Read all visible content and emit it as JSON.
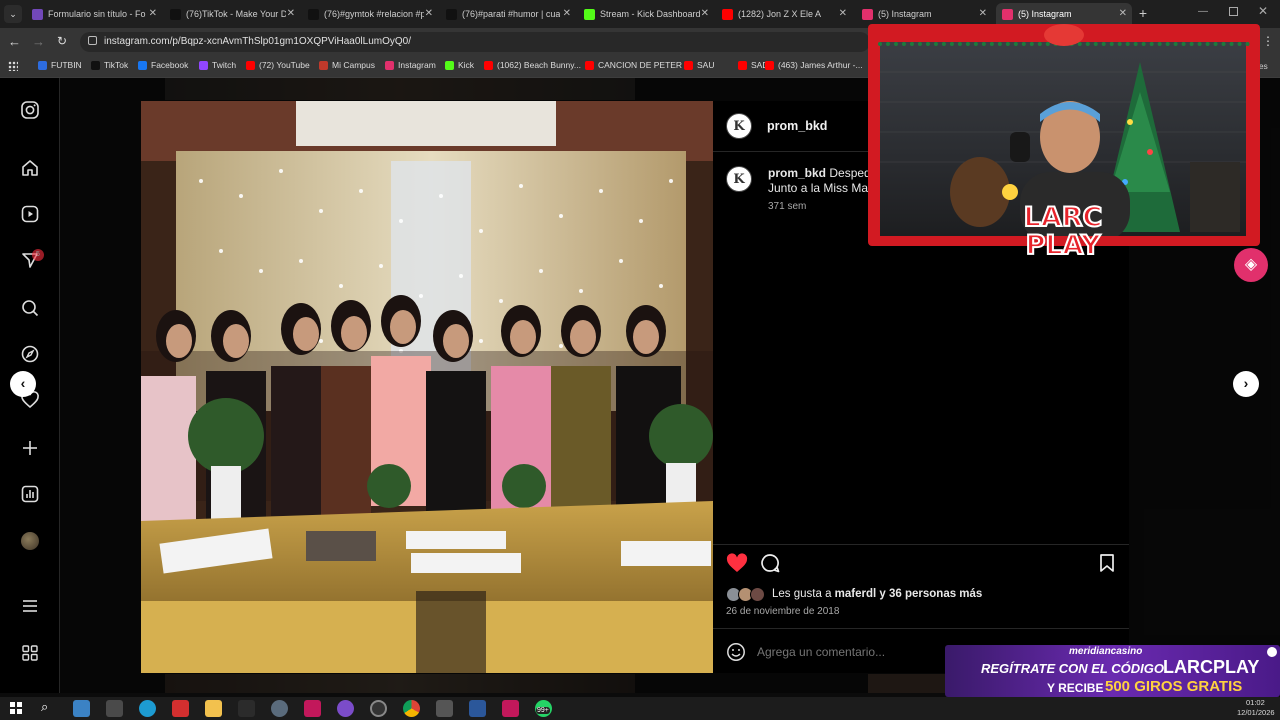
{
  "browser": {
    "tabs": [
      {
        "title": "Formulario sin título - Fo",
        "color": "#7248b9"
      },
      {
        "title": "(76)TikTok - Make Your D",
        "color": "#111111"
      },
      {
        "title": "(76)#gymtok #relacion #p",
        "color": "#111111"
      },
      {
        "title": "(76)#parati #humor | cua",
        "color": "#111111"
      },
      {
        "title": "Stream - Kick Dashboard",
        "color": "#53fc18"
      },
      {
        "title": "(1282) Jon Z X Ele A",
        "color": "#ff0000"
      },
      {
        "title": "(5) Instagram",
        "color": "#e1306c"
      },
      {
        "title": "(5) Instagram",
        "color": "#e1306c"
      }
    ],
    "url": "instagram.com/p/Bqpz-xcnAvmThSlp01gm1OXQPViHaa0lLumOyQ0/",
    "bookmarks": [
      {
        "label": "FUTBIN",
        "color": "#2d6cdf"
      },
      {
        "label": "TikTok",
        "color": "#111111"
      },
      {
        "label": "Facebook",
        "color": "#1877f2"
      },
      {
        "label": "Twitch",
        "color": "#9146ff"
      },
      {
        "label": "(72) YouTube",
        "color": "#ff0000"
      },
      {
        "label": "Mi Campus",
        "color": "#c0392b"
      },
      {
        "label": "Instagram",
        "color": "#e1306c"
      },
      {
        "label": "Kick",
        "color": "#53fc18"
      },
      {
        "label": "(1062) Beach Bunny...",
        "color": "#ff0000"
      },
      {
        "label": "CANCION DE PETER",
        "color": "#ff0000"
      },
      {
        "label": "SAU",
        "color": "#ff0000"
      },
      {
        "label": "SAD",
        "color": "#ff0000"
      },
      {
        "label": "(463) James Arthur -...",
        "color": "#ff0000"
      }
    ],
    "bookmarks_overflow": "res"
  },
  "sidebar": {
    "notification_badge": "5"
  },
  "post": {
    "username": "prom_bkd",
    "caption_user": "prom_bkd",
    "caption_line1": "Despedid",
    "caption_line2": "Junto a la Miss Marth",
    "caption_time": "371 sem",
    "likes_prefix": "Les gusta a ",
    "likes_user": "maferdl",
    "likes_suffix": " y 36 personas más",
    "date": "26 de noviembre de 2018",
    "comment_placeholder": "Agrega un comentario..."
  },
  "overlay": {
    "brand_line1": "LARC",
    "brand_line2": "PLAY",
    "ad_brand": "meridiancasino",
    "ad_line1": "REGÍTRATE CON EL CÓDIGO",
    "ad_code": "LARCPLAY",
    "ad_line2_prefix": "Y RECIBE",
    "ad_line2_highlight": "500 GIROS GRATIS"
  },
  "taskbar": {
    "time": "01:02",
    "date": "12/01/2026",
    "notification_count": "99+"
  },
  "colors": {
    "heart": "#ff3040",
    "kick_green": "#53fc18",
    "instagram": "#e1306c"
  }
}
